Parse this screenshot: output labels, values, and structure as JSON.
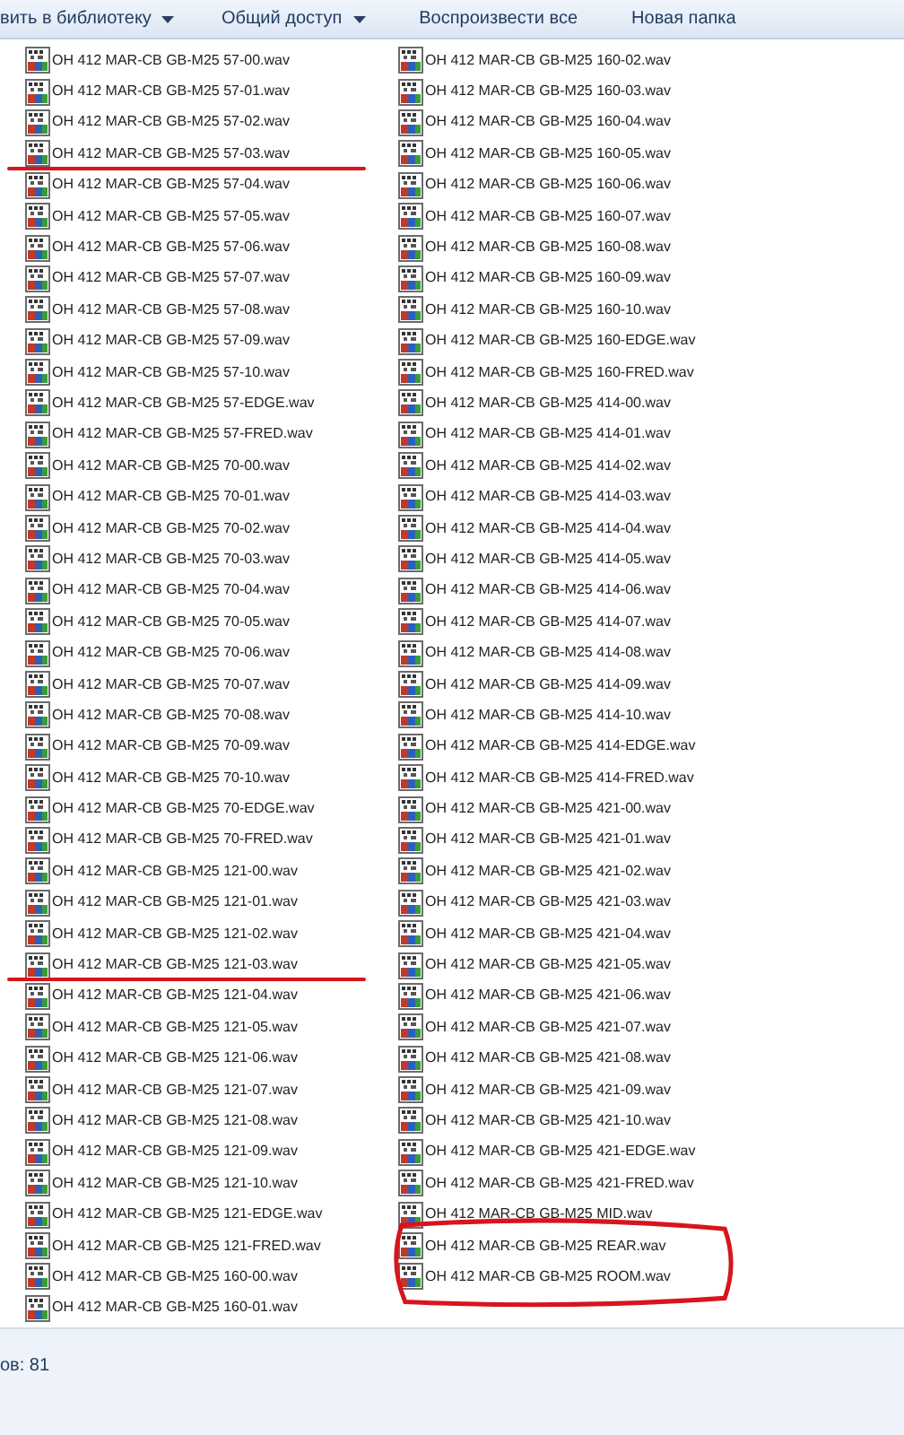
{
  "toolbar": [
    {
      "label": "вить в библиотеку",
      "has_menu": true
    },
    {
      "label": "Общий доступ",
      "has_menu": true
    },
    {
      "label": "Воспроизвести все",
      "has_menu": false
    },
    {
      "label": "Новая папка",
      "has_menu": false
    }
  ],
  "columns": [
    {
      "items": [
        {
          "name": "OH 412 MAR-CB GB-M25 57-00.wav",
          "underlined": false,
          "circled": false
        },
        {
          "name": "OH 412 MAR-CB GB-M25 57-01.wav",
          "underlined": false,
          "circled": false
        },
        {
          "name": "OH 412 MAR-CB GB-M25 57-02.wav",
          "underlined": false,
          "circled": false
        },
        {
          "name": "OH 412 MAR-CB GB-M25 57-03.wav",
          "underlined": true,
          "circled": false
        },
        {
          "name": "OH 412 MAR-CB GB-M25 57-04.wav",
          "underlined": false,
          "circled": false
        },
        {
          "name": "OH 412 MAR-CB GB-M25 57-05.wav",
          "underlined": false,
          "circled": false
        },
        {
          "name": "OH 412 MAR-CB GB-M25 57-06.wav",
          "underlined": false,
          "circled": false
        },
        {
          "name": "OH 412 MAR-CB GB-M25 57-07.wav",
          "underlined": false,
          "circled": false
        },
        {
          "name": "OH 412 MAR-CB GB-M25 57-08.wav",
          "underlined": false,
          "circled": false
        },
        {
          "name": "OH 412 MAR-CB GB-M25 57-09.wav",
          "underlined": false,
          "circled": false
        },
        {
          "name": "OH 412 MAR-CB GB-M25 57-10.wav",
          "underlined": false,
          "circled": false
        },
        {
          "name": "OH 412 MAR-CB GB-M25 57-EDGE.wav",
          "underlined": false,
          "circled": false
        },
        {
          "name": "OH 412 MAR-CB GB-M25 57-FRED.wav",
          "underlined": false,
          "circled": false
        },
        {
          "name": "OH 412 MAR-CB GB-M25 70-00.wav",
          "underlined": false,
          "circled": false
        },
        {
          "name": "OH 412 MAR-CB GB-M25 70-01.wav",
          "underlined": false,
          "circled": false
        },
        {
          "name": "OH 412 MAR-CB GB-M25 70-02.wav",
          "underlined": false,
          "circled": false
        },
        {
          "name": "OH 412 MAR-CB GB-M25 70-03.wav",
          "underlined": false,
          "circled": false
        },
        {
          "name": "OH 412 MAR-CB GB-M25 70-04.wav",
          "underlined": false,
          "circled": false
        },
        {
          "name": "OH 412 MAR-CB GB-M25 70-05.wav",
          "underlined": false,
          "circled": false
        },
        {
          "name": "OH 412 MAR-CB GB-M25 70-06.wav",
          "underlined": false,
          "circled": false
        },
        {
          "name": "OH 412 MAR-CB GB-M25 70-07.wav",
          "underlined": false,
          "circled": false
        },
        {
          "name": "OH 412 MAR-CB GB-M25 70-08.wav",
          "underlined": false,
          "circled": false
        },
        {
          "name": "OH 412 MAR-CB GB-M25 70-09.wav",
          "underlined": false,
          "circled": false
        },
        {
          "name": "OH 412 MAR-CB GB-M25 70-10.wav",
          "underlined": false,
          "circled": false
        },
        {
          "name": "OH 412 MAR-CB GB-M25 70-EDGE.wav",
          "underlined": false,
          "circled": false
        },
        {
          "name": "OH 412 MAR-CB GB-M25 70-FRED.wav",
          "underlined": false,
          "circled": false
        },
        {
          "name": "OH 412 MAR-CB GB-M25 121-00.wav",
          "underlined": false,
          "circled": false
        },
        {
          "name": "OH 412 MAR-CB GB-M25 121-01.wav",
          "underlined": false,
          "circled": false
        },
        {
          "name": "OH 412 MAR-CB GB-M25 121-02.wav",
          "underlined": false,
          "circled": false
        },
        {
          "name": "OH 412 MAR-CB GB-M25 121-03.wav",
          "underlined": true,
          "circled": false
        },
        {
          "name": "OH 412 MAR-CB GB-M25 121-04.wav",
          "underlined": false,
          "circled": false
        },
        {
          "name": "OH 412 MAR-CB GB-M25 121-05.wav",
          "underlined": false,
          "circled": false
        },
        {
          "name": "OH 412 MAR-CB GB-M25 121-06.wav",
          "underlined": false,
          "circled": false
        },
        {
          "name": "OH 412 MAR-CB GB-M25 121-07.wav",
          "underlined": false,
          "circled": false
        },
        {
          "name": "OH 412 MAR-CB GB-M25 121-08.wav",
          "underlined": false,
          "circled": false
        },
        {
          "name": "OH 412 MAR-CB GB-M25 121-09.wav",
          "underlined": false,
          "circled": false
        },
        {
          "name": "OH 412 MAR-CB GB-M25 121-10.wav",
          "underlined": false,
          "circled": false
        },
        {
          "name": "OH 412 MAR-CB GB-M25 121-EDGE.wav",
          "underlined": false,
          "circled": false
        },
        {
          "name": "OH 412 MAR-CB GB-M25 121-FRED.wav",
          "underlined": false,
          "circled": false
        },
        {
          "name": "OH 412 MAR-CB GB-M25 160-00.wav",
          "underlined": false,
          "circled": false
        },
        {
          "name": "OH 412 MAR-CB GB-M25 160-01.wav",
          "underlined": false,
          "circled": false
        }
      ]
    },
    {
      "items": [
        {
          "name": "OH 412 MAR-CB GB-M25 160-02.wav",
          "underlined": false,
          "circled": false
        },
        {
          "name": "OH 412 MAR-CB GB-M25 160-03.wav",
          "underlined": false,
          "circled": false
        },
        {
          "name": "OH 412 MAR-CB GB-M25 160-04.wav",
          "underlined": false,
          "circled": false
        },
        {
          "name": "OH 412 MAR-CB GB-M25 160-05.wav",
          "underlined": false,
          "circled": false
        },
        {
          "name": "OH 412 MAR-CB GB-M25 160-06.wav",
          "underlined": false,
          "circled": false
        },
        {
          "name": "OH 412 MAR-CB GB-M25 160-07.wav",
          "underlined": false,
          "circled": false
        },
        {
          "name": "OH 412 MAR-CB GB-M25 160-08.wav",
          "underlined": false,
          "circled": false
        },
        {
          "name": "OH 412 MAR-CB GB-M25 160-09.wav",
          "underlined": false,
          "circled": false
        },
        {
          "name": "OH 412 MAR-CB GB-M25 160-10.wav",
          "underlined": false,
          "circled": false
        },
        {
          "name": "OH 412 MAR-CB GB-M25 160-EDGE.wav",
          "underlined": false,
          "circled": false
        },
        {
          "name": "OH 412 MAR-CB GB-M25 160-FRED.wav",
          "underlined": false,
          "circled": false
        },
        {
          "name": "OH 412 MAR-CB GB-M25 414-00.wav",
          "underlined": false,
          "circled": false
        },
        {
          "name": "OH 412 MAR-CB GB-M25 414-01.wav",
          "underlined": false,
          "circled": false
        },
        {
          "name": "OH 412 MAR-CB GB-M25 414-02.wav",
          "underlined": false,
          "circled": false
        },
        {
          "name": "OH 412 MAR-CB GB-M25 414-03.wav",
          "underlined": false,
          "circled": false
        },
        {
          "name": "OH 412 MAR-CB GB-M25 414-04.wav",
          "underlined": false,
          "circled": false
        },
        {
          "name": "OH 412 MAR-CB GB-M25 414-05.wav",
          "underlined": false,
          "circled": false
        },
        {
          "name": "OH 412 MAR-CB GB-M25 414-06.wav",
          "underlined": false,
          "circled": false
        },
        {
          "name": "OH 412 MAR-CB GB-M25 414-07.wav",
          "underlined": false,
          "circled": false
        },
        {
          "name": "OH 412 MAR-CB GB-M25 414-08.wav",
          "underlined": false,
          "circled": false
        },
        {
          "name": "OH 412 MAR-CB GB-M25 414-09.wav",
          "underlined": false,
          "circled": false
        },
        {
          "name": "OH 412 MAR-CB GB-M25 414-10.wav",
          "underlined": false,
          "circled": false
        },
        {
          "name": "OH 412 MAR-CB GB-M25 414-EDGE.wav",
          "underlined": false,
          "circled": false
        },
        {
          "name": "OH 412 MAR-CB GB-M25 414-FRED.wav",
          "underlined": false,
          "circled": false
        },
        {
          "name": "OH 412 MAR-CB GB-M25 421-00.wav",
          "underlined": false,
          "circled": false
        },
        {
          "name": "OH 412 MAR-CB GB-M25 421-01.wav",
          "underlined": false,
          "circled": false
        },
        {
          "name": "OH 412 MAR-CB GB-M25 421-02.wav",
          "underlined": false,
          "circled": false
        },
        {
          "name": "OH 412 MAR-CB GB-M25 421-03.wav",
          "underlined": false,
          "circled": false
        },
        {
          "name": "OH 412 MAR-CB GB-M25 421-04.wav",
          "underlined": false,
          "circled": false
        },
        {
          "name": "OH 412 MAR-CB GB-M25 421-05.wav",
          "underlined": false,
          "circled": false
        },
        {
          "name": "OH 412 MAR-CB GB-M25 421-06.wav",
          "underlined": false,
          "circled": false
        },
        {
          "name": "OH 412 MAR-CB GB-M25 421-07.wav",
          "underlined": false,
          "circled": false
        },
        {
          "name": "OH 412 MAR-CB GB-M25 421-08.wav",
          "underlined": false,
          "circled": false
        },
        {
          "name": "OH 412 MAR-CB GB-M25 421-09.wav",
          "underlined": false,
          "circled": false
        },
        {
          "name": "OH 412 MAR-CB GB-M25 421-10.wav",
          "underlined": false,
          "circled": false
        },
        {
          "name": "OH 412 MAR-CB GB-M25 421-EDGE.wav",
          "underlined": false,
          "circled": false
        },
        {
          "name": "OH 412 MAR-CB GB-M25 421-FRED.wav",
          "underlined": false,
          "circled": false
        },
        {
          "name": "OH 412 MAR-CB GB-M25 MID.wav",
          "underlined": false,
          "circled": false
        },
        {
          "name": "OH 412 MAR-CB GB-M25 REAR.wav",
          "underlined": false,
          "circled": true
        },
        {
          "name": "OH 412 MAR-CB GB-M25 ROOM.wav",
          "underlined": false,
          "circled": true
        }
      ]
    }
  ],
  "status_bar": {
    "text": "ов: 81"
  }
}
